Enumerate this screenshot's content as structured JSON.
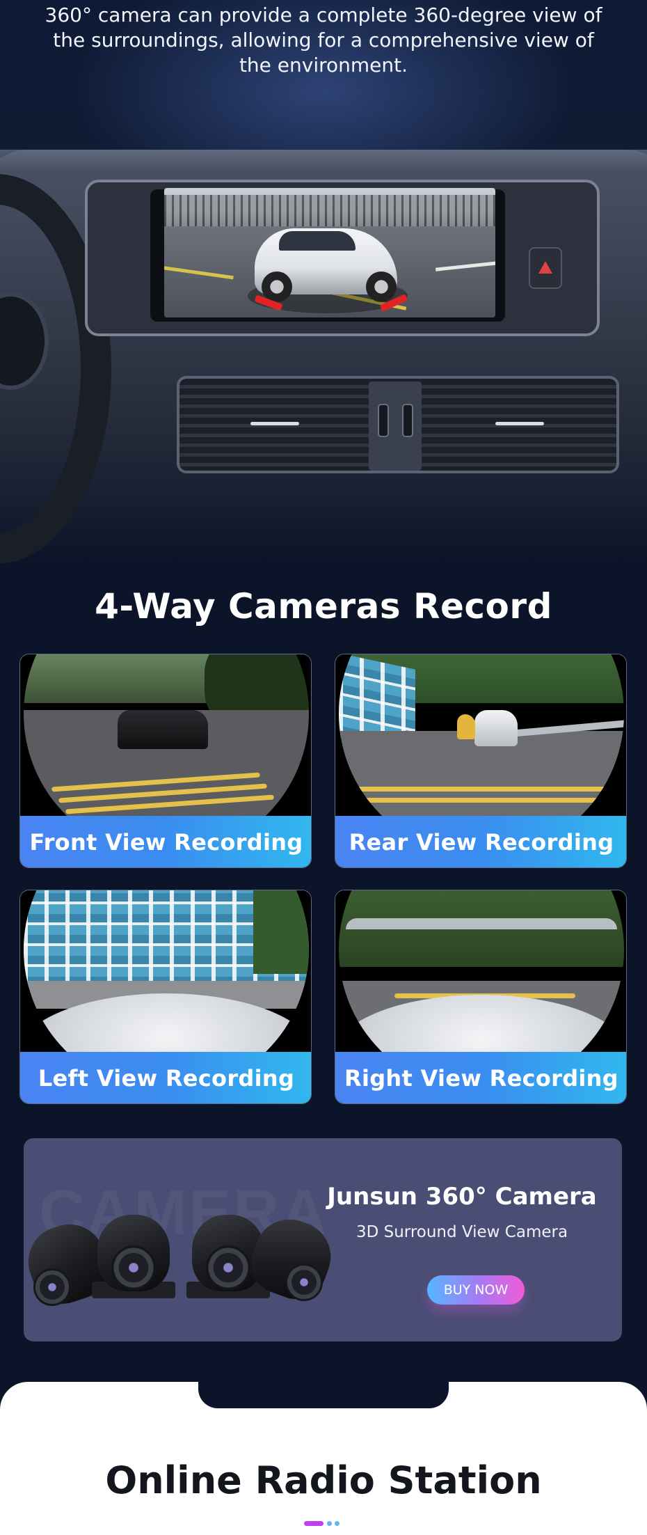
{
  "hero": {
    "description": "360° camera can provide a complete 360-degree view of the surroundings, allowing for a comprehensive view of the environment."
  },
  "cameras_section": {
    "title": "4-Way Cameras Record",
    "cards": [
      {
        "label": "Front View Recording"
      },
      {
        "label": "Rear View Recording"
      },
      {
        "label": "Left View Recording"
      },
      {
        "label": "Right View Recording"
      }
    ]
  },
  "promo": {
    "watermark": "CAMERA",
    "title": "Junsun 360° Camera",
    "subtitle": "3D Surround View Camera",
    "buy_label": "BUY NOW"
  },
  "radio_section": {
    "title": "Online Radio Station"
  },
  "colors": {
    "page_bg": "#0b1428",
    "label_gradient_start": "#4a84f2",
    "label_gradient_end": "#31b8ee",
    "promo_bg": "#4a4d74",
    "buy_gradient": [
      "#55b6ff",
      "#a979f3",
      "#f05bd8"
    ],
    "dot_active": "#c13ff0",
    "dot_inactive": "#5fb6f0"
  }
}
